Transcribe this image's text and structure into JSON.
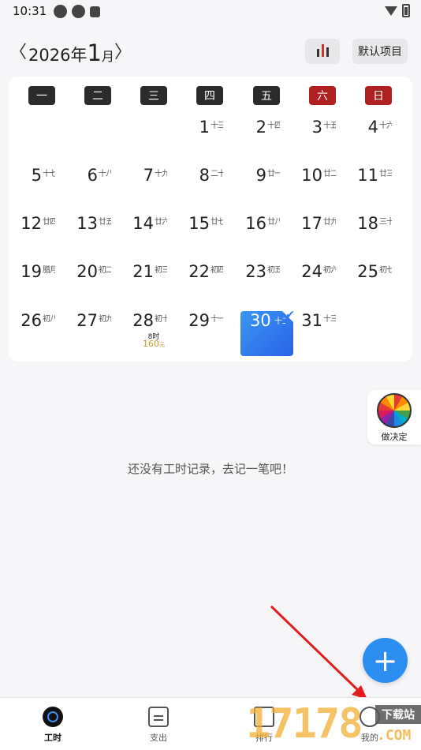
{
  "status_bar": {
    "time": "10:31"
  },
  "header": {
    "year_label": "2026年",
    "month_num": "1",
    "month_suffix": "月",
    "prev_label": "〈",
    "next_label": "〉",
    "project_label": "默认项目"
  },
  "weekdays": [
    "一",
    "二",
    "三",
    "四",
    "五",
    "六",
    "日"
  ],
  "calendar": {
    "days": [
      {
        "n": "1",
        "lunar": "十三"
      },
      {
        "n": "2",
        "lunar": "十四"
      },
      {
        "n": "3",
        "lunar": "十五"
      },
      {
        "n": "4",
        "lunar": "十六"
      },
      {
        "n": "5",
        "lunar": "十七"
      },
      {
        "n": "6",
        "lunar": "十八"
      },
      {
        "n": "7",
        "lunar": "十九"
      },
      {
        "n": "8",
        "lunar": "二十"
      },
      {
        "n": "9",
        "lunar": "廿一"
      },
      {
        "n": "10",
        "lunar": "廿二"
      },
      {
        "n": "11",
        "lunar": "廿三"
      },
      {
        "n": "12",
        "lunar": "廿四"
      },
      {
        "n": "13",
        "lunar": "廿五"
      },
      {
        "n": "14",
        "lunar": "廿六"
      },
      {
        "n": "15",
        "lunar": "廿七"
      },
      {
        "n": "16",
        "lunar": "廿八"
      },
      {
        "n": "17",
        "lunar": "廿九"
      },
      {
        "n": "18",
        "lunar": "三十"
      },
      {
        "n": "19",
        "lunar": "腊月"
      },
      {
        "n": "20",
        "lunar": "初二"
      },
      {
        "n": "21",
        "lunar": "初三"
      },
      {
        "n": "22",
        "lunar": "初四"
      },
      {
        "n": "23",
        "lunar": "初五"
      },
      {
        "n": "24",
        "lunar": "初六"
      },
      {
        "n": "25",
        "lunar": "初七"
      },
      {
        "n": "26",
        "lunar": "初八"
      },
      {
        "n": "27",
        "lunar": "初九"
      },
      {
        "n": "28",
        "lunar": "初十",
        "hours": "8时",
        "amount": "160",
        "unit": "元"
      },
      {
        "n": "29",
        "lunar": "十一"
      },
      {
        "n": "30",
        "lunar": "十二",
        "today": true
      },
      {
        "n": "31",
        "lunar": "十三"
      }
    ]
  },
  "decide": {
    "label": "做决定"
  },
  "empty_text": "还没有工时记录，去记一笔吧！",
  "fab": {
    "label": "+"
  },
  "bottom_nav": [
    {
      "label": "工时",
      "icon": "hours-icon",
      "active": true
    },
    {
      "label": "支出",
      "icon": "expense-icon",
      "active": false
    },
    {
      "label": "排行",
      "icon": "rank-icon",
      "active": false
    },
    {
      "label": "我的",
      "icon": "me-icon",
      "active": false
    }
  ],
  "watermark": {
    "digits": "17178",
    "box": "下载站",
    "com": ".COM"
  },
  "colors": {
    "accent": "#2b8ef0",
    "weekend": "#b02020",
    "amount": "#c9962a"
  }
}
